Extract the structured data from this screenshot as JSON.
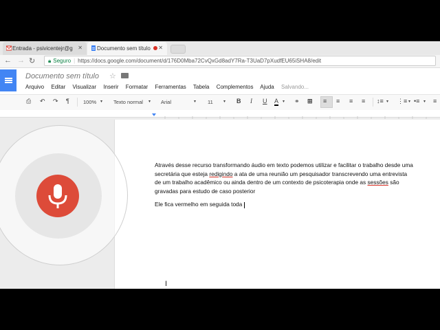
{
  "browser": {
    "tabs": [
      {
        "label": "Entrada - psivicentejr@g",
        "icon": "gmail-icon",
        "active": false
      },
      {
        "label": "Documento sem título",
        "icon": "docs-icon",
        "active": true
      }
    ],
    "secure_label": "Seguro",
    "url": "https://docs.google.com/document/d/176D0Mba72CvQxGd8adY7Ra-T3UaD7pXudfEU65iSHA8/edit"
  },
  "doc": {
    "title": "Documento sem título",
    "menu": [
      "Arquivo",
      "Editar",
      "Visualizar",
      "Inserir",
      "Formatar",
      "Ferramentas",
      "Tabela",
      "Complementos",
      "Ajuda"
    ],
    "status": "Salvando..."
  },
  "toolbar": {
    "zoom": "100%",
    "style": "Texto normal",
    "font": "Arial",
    "size": "11"
  },
  "content": {
    "p1_a": "Através desse recurso transformando áudio em texto podemos utilizar e facilitar o trabalho desde uma secretária que esteja ",
    "p1_u1": "redigindo",
    "p1_b": " a ata de uma reunião um pesquisador transcrevendo uma entrevista de um trabalho acadêmico ou ainda dentro de um contexto de psicoterapia onde as ",
    "p1_u2": "sessões",
    "p1_c": " são gravadas para estudo de caso posterior",
    "p2": "Ele fica vermelho em seguida toda"
  },
  "colors": {
    "mic_active": "#dd4b39",
    "docs_blue": "#4285f4",
    "secure_green": "#0b8043"
  }
}
